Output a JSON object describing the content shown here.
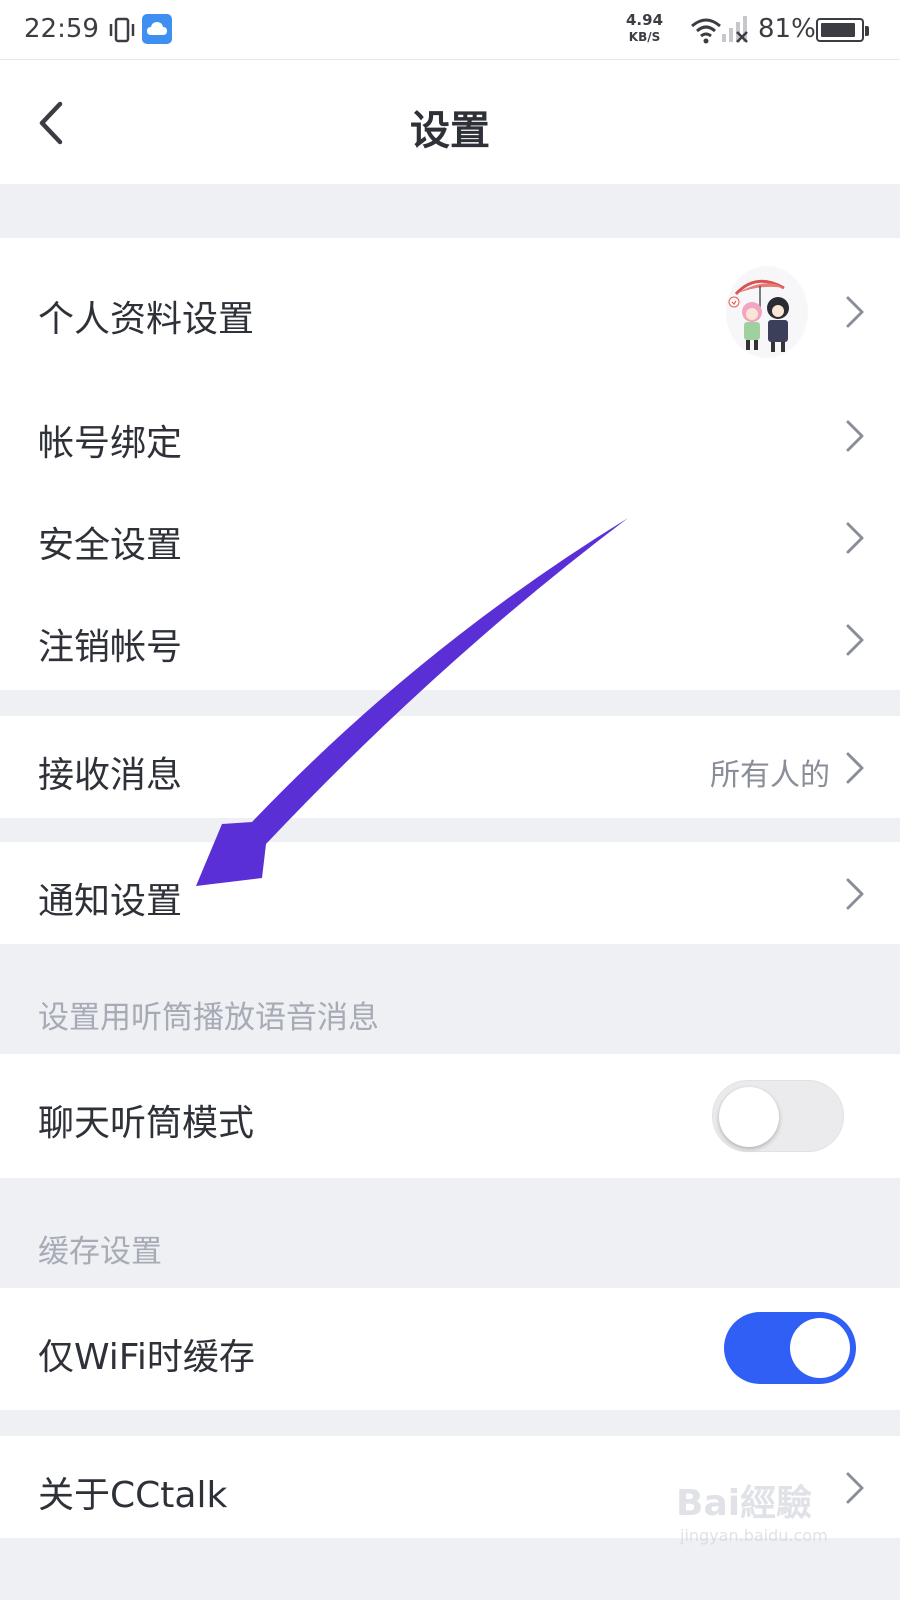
{
  "status_bar": {
    "time": "22:59",
    "speed_value": "4.94",
    "speed_unit": "KB/S",
    "battery": "81%",
    "icons": [
      "vibrate-icon",
      "cloud-icon",
      "wifi-icon",
      "signal-icon",
      "battery-icon"
    ]
  },
  "header": {
    "title": "设置",
    "back_icon": "back-chevron-icon"
  },
  "groups": {
    "account": [
      {
        "label": "个人资料设置",
        "has_avatar": true
      },
      {
        "label": "帐号绑定"
      },
      {
        "label": "安全设置"
      },
      {
        "label": "注销帐号"
      }
    ],
    "messages": {
      "label": "接收消息",
      "value": "所有人的"
    },
    "notifications": {
      "label": "通知设置"
    },
    "earpiece_section_label": "设置用听筒播放语音消息",
    "earpiece": {
      "label": "聊天听筒模式",
      "enabled": false
    },
    "cache_section_label": "缓存设置",
    "cache": {
      "label": "仅WiFi时缓存",
      "enabled": true
    },
    "about": {
      "label": "关于CCtalk"
    }
  },
  "watermark": {
    "brand": "Bai經驗",
    "url": "jingyan.baidu.com"
  },
  "colors": {
    "toggle_on": "#2f5ff5",
    "arrow": "#5b2fd6",
    "section_bg": "#eef0f4"
  }
}
